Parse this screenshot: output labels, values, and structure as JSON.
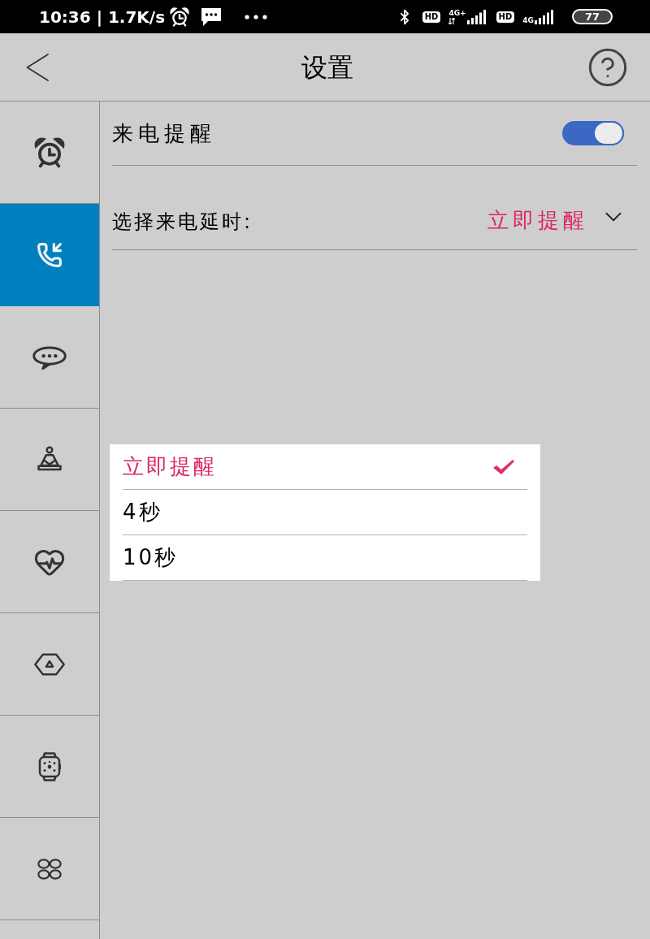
{
  "status_bar": {
    "text": "10:36 | 1.7K/s",
    "sims": [
      {
        "badge": "HD",
        "network": "4G+",
        "transfer": true
      },
      {
        "badge": "HD",
        "network": "4G",
        "transfer": false
      }
    ],
    "battery": "77"
  },
  "header": {
    "title": "设置"
  },
  "sidebar": {
    "items": [
      {
        "kind": "alarm",
        "selected": false
      },
      {
        "kind": "incoming-call",
        "selected": true
      },
      {
        "kind": "message",
        "selected": false
      },
      {
        "kind": "meditation",
        "selected": false
      },
      {
        "kind": "heart-rate",
        "selected": false
      },
      {
        "kind": "hexagon",
        "selected": false
      },
      {
        "kind": "watch",
        "selected": false
      },
      {
        "kind": "apps",
        "selected": false
      }
    ]
  },
  "settings": [
    {
      "kind": "toggle",
      "label": "来电提醒",
      "on": true
    },
    {
      "kind": "select",
      "label": "选择来电延时:",
      "value": "立即提醒"
    }
  ],
  "dropdown": {
    "options": [
      {
        "label": "立即提醒",
        "selected": true
      },
      {
        "label": "4秒",
        "selected": false
      },
      {
        "label": "10秒",
        "selected": false
      }
    ]
  }
}
